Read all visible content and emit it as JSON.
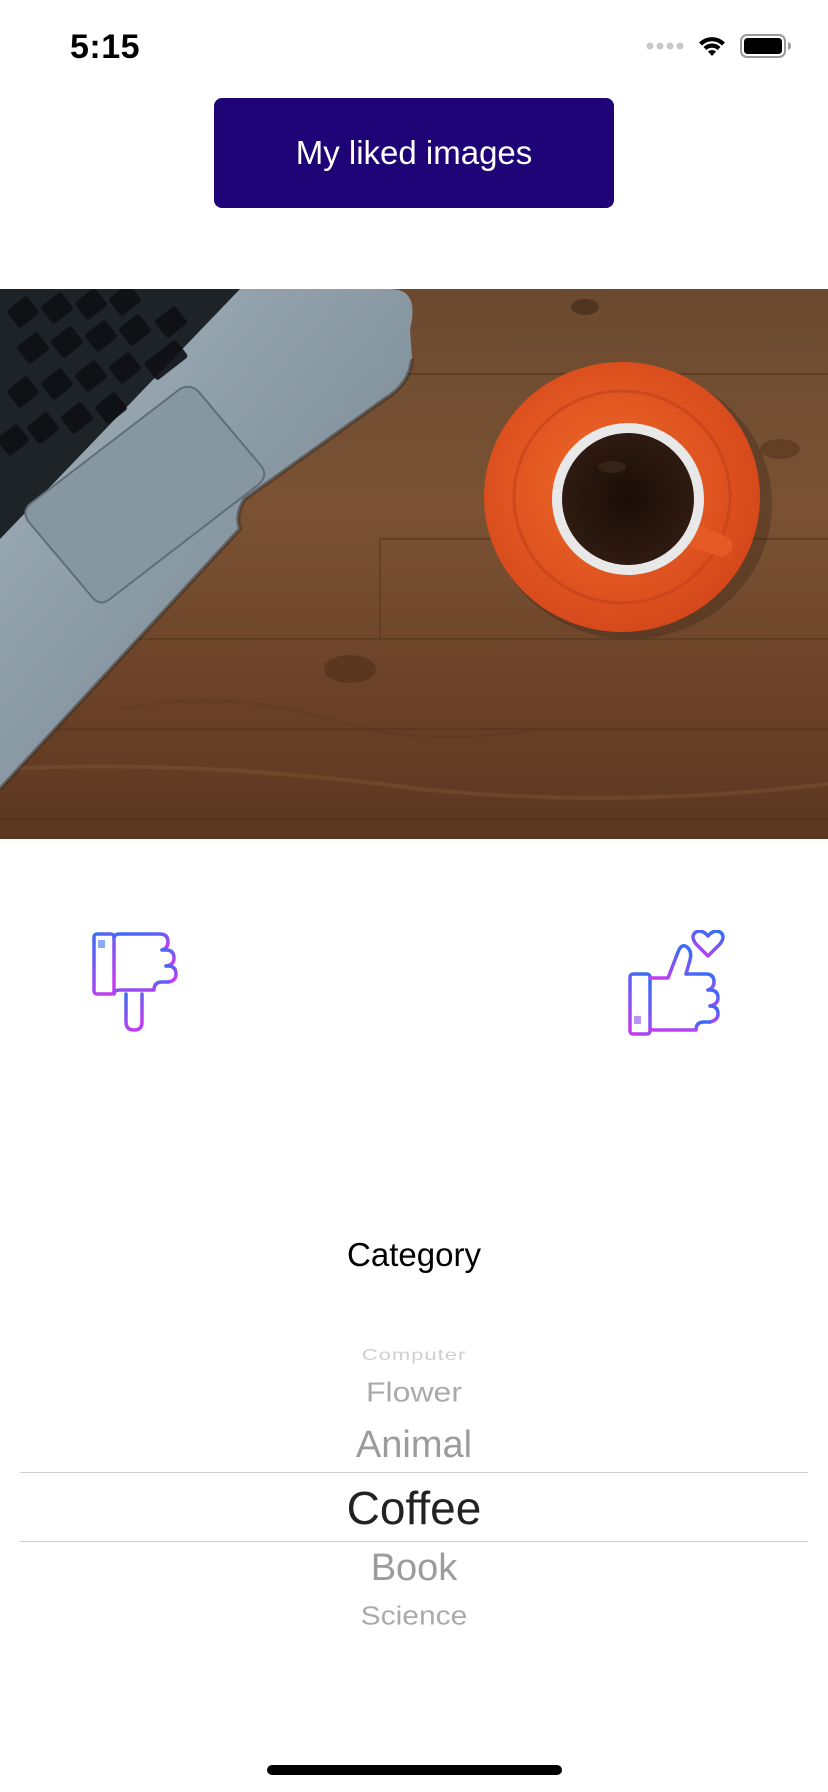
{
  "status_bar": {
    "time": "5:15",
    "icons": [
      "signal-dots-icon",
      "wifi-icon",
      "battery-icon"
    ]
  },
  "header": {
    "liked_button_label": "My liked images"
  },
  "photo": {
    "subject": "laptop-and-coffee-photo"
  },
  "reactions": {
    "dislike_icon": "thumbs-down-icon",
    "like_icon": "thumbs-up-heart-icon"
  },
  "category": {
    "label": "Category",
    "options": [
      "Computer",
      "Flower",
      "Animal",
      "Coffee",
      "Book",
      "Science"
    ],
    "selected": "Coffee"
  },
  "colors": {
    "button_bg": "#1e0477",
    "icon_gradient_start": "#3b6cf5",
    "icon_gradient_end": "#c13ef0"
  }
}
